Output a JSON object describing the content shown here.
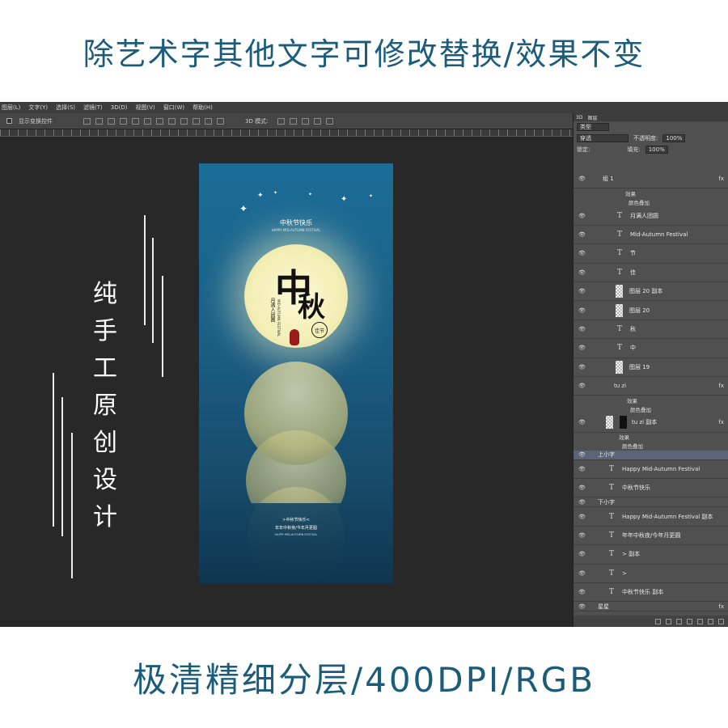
{
  "top_banner": "除艺术字其他文字可修改替换/效果不变",
  "bottom_banner": "极清精细分层/400DPI/RGB",
  "side_text": [
    "纯",
    "手",
    "工",
    "原",
    "创",
    "设",
    "计"
  ],
  "menu": [
    "图层(L)",
    "文字(Y)",
    "选择(S)",
    "滤镜(T)",
    "3D(D)",
    "视图(V)",
    "窗口(W)",
    "帮助(H)"
  ],
  "options": {
    "show_transform": "显示变换控件",
    "mode_3d": "3D 模式:"
  },
  "poster": {
    "headline": "中秋节快乐",
    "headline_en": "HAPPY MID-AUTUMN FESTIVAL",
    "cal_zhong": "中",
    "cal_qiu": "秋",
    "side_cn": "月满人团圆",
    "side_en": "MID-AUTUMN FESTIVAL",
    "stamp": "佳节",
    "bottom_line1": ">中秋节快乐<",
    "bottom_line2": "年年中秋夜/今年月更圆",
    "bottom_line3": "HAPPY MID-AUTUMN FESTIVAL"
  },
  "panel": {
    "tabs": [
      "3D",
      "图层"
    ],
    "filter": "类型",
    "blend_mode": "穿透",
    "opacity_label": "不透明度:",
    "opacity_value": "100%",
    "lock_label": "锁定:",
    "fill_label": "填充:",
    "fill_value": "100%",
    "group1": "组 1",
    "effect": "效果",
    "color_overlay": "颜色叠加",
    "layers": [
      {
        "kind": "T",
        "name": "月满人团圆"
      },
      {
        "kind": "T",
        "name": "Mid-Autumn Festival"
      },
      {
        "kind": "T",
        "name": "节"
      },
      {
        "kind": "T",
        "name": "佳"
      },
      {
        "kind": "img",
        "name": "图层 20 副本"
      },
      {
        "kind": "img",
        "name": "图层 20"
      },
      {
        "kind": "T",
        "name": "秋"
      },
      {
        "kind": "T",
        "name": "中"
      },
      {
        "kind": "img",
        "name": "图层 19"
      }
    ],
    "tuzi": "tu zi",
    "tuzi_copy": "tu zi 副本",
    "group_upper": "上小字",
    "upper_layers": [
      "Happy Mid-Autumn Festival",
      "中秋节快乐"
    ],
    "group_lower": "下小字",
    "lower_layers": [
      "Happy Mid-Autumn Festival 副本",
      "年年中秋夜/今年月更圆",
      "> 副本",
      ">",
      "中秋节快乐 副本"
    ],
    "group_stars": "星星"
  }
}
